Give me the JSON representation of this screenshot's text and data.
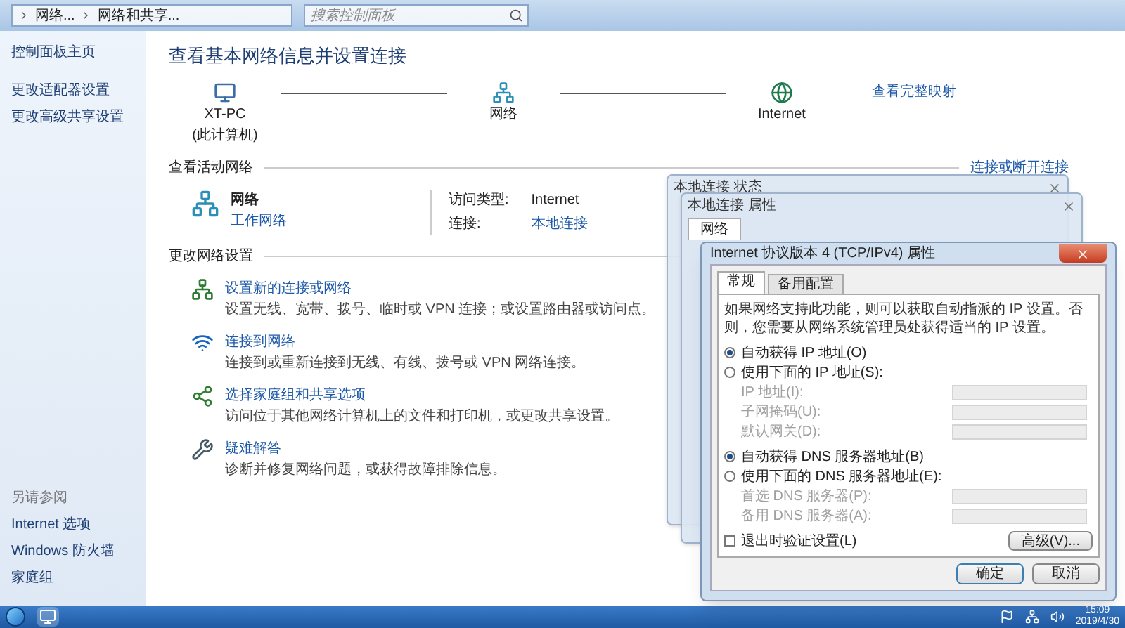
{
  "window": {
    "breadcrumbs": [
      "网络...",
      "网络和共享..."
    ],
    "search": {
      "placeholder": "搜索控制面板"
    }
  },
  "sidebar": {
    "items": [
      "控制面板主页",
      "更改适配器设置",
      "更改高级共享设置"
    ],
    "see_also": {
      "title": "另请参阅",
      "items": [
        "Internet 选项",
        "Windows 防火墙",
        "家庭组"
      ]
    }
  },
  "main": {
    "title": "查看基本网络信息并设置连接",
    "map": {
      "nodes": [
        {
          "kind": "computer",
          "label": "XT-PC",
          "sublabel": "(此计算机)"
        },
        {
          "kind": "network",
          "label": "网络"
        },
        {
          "kind": "internet",
          "label": "Internet"
        }
      ],
      "full_map_link": "查看完整映射"
    },
    "active_networks": {
      "heading": "查看活动网络",
      "link": "连接或断开连接",
      "network_name": "网络",
      "network_type": "工作网络",
      "access_type_label": "访问类型:",
      "access_type": "Internet",
      "connection_label": "连接:",
      "connection": "本地连接"
    },
    "change_settings": {
      "heading": "更改网络设置",
      "items": [
        {
          "kind": "new-connection",
          "title": "设置新的连接或网络",
          "description": "设置无线、宽带、拨号、临时或 VPN 连接；或设置路由器或访问点。"
        },
        {
          "kind": "connect",
          "title": "连接到网络",
          "description": "连接到或重新连接到无线、有线、拨号或 VPN 网络连接。"
        },
        {
          "kind": "homegroup",
          "title": "选择家庭组和共享选项",
          "description": "访问位于其他网络计算机上的文件和打印机，或更改共享设置。"
        },
        {
          "kind": "troubleshoot",
          "title": "疑难解答",
          "description": "诊断并修复网络问题，或获得故障排除信息。"
        }
      ]
    }
  },
  "back_dialogs": [
    {
      "title": "本地连接 状态"
    },
    {
      "title": "本地连接 属性",
      "tabs": [
        {
          "label": "网络",
          "selected": true
        }
      ]
    }
  ],
  "ipv4_dialog": {
    "title": "Internet 协议版本 4 (TCP/IPv4) 属性",
    "tabs": [
      {
        "label": "常规",
        "selected": true
      },
      {
        "label": "备用配置",
        "selected": false
      }
    ],
    "intro": "如果网络支持此功能，则可以获取自动指派的 IP 设置。否则，您需要从网络系统管理员处获得适当的 IP 设置。",
    "ip_options": [
      {
        "label": "自动获得 IP 地址(O)",
        "selected": true
      },
      {
        "label": "使用下面的 IP 地址(S):",
        "selected": false
      }
    ],
    "ip_fields": [
      {
        "label": "IP 地址(I):",
        "disabled": true
      },
      {
        "label": "子网掩码(U):",
        "disabled": true
      },
      {
        "label": "默认网关(D):",
        "disabled": true
      }
    ],
    "dns_options": [
      {
        "label": "自动获得 DNS 服务器地址(B)",
        "selected": true
      },
      {
        "label": "使用下面的 DNS 服务器地址(E):",
        "selected": false
      }
    ],
    "dns_fields": [
      {
        "label": "首选 DNS 服务器(P):",
        "disabled": true
      },
      {
        "label": "备用 DNS 服务器(A):",
        "disabled": true
      }
    ],
    "validate": {
      "label": "退出时验证设置(L)",
      "checked": false
    },
    "advanced_button": "高级(V)...",
    "buttons": [
      "确定",
      "取消"
    ]
  },
  "taskbar": {
    "time": "15:09",
    "date": "2019/4/30"
  }
}
